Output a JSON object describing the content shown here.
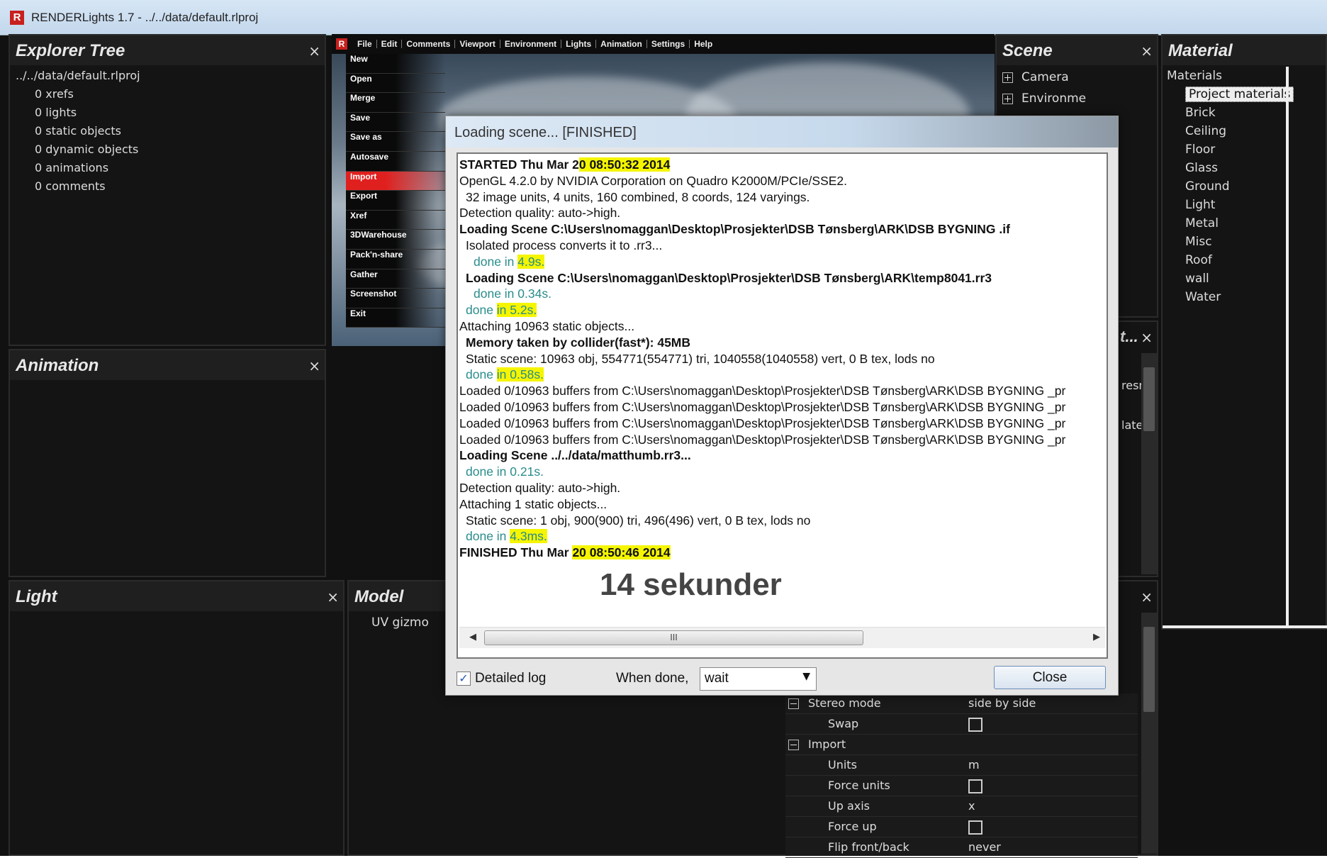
{
  "window": {
    "title": "RENDERLights 1.7 - ../../data/default.rlproj",
    "logo": "R"
  },
  "explorer": {
    "title": "Explorer Tree",
    "close": "×",
    "items": [
      "../../data/default.rlproj",
      "0 xrefs",
      "0 lights",
      "0 static objects",
      "0 dynamic objects",
      "0 animations",
      "0 comments"
    ]
  },
  "animation": {
    "title": "Animation",
    "close": "×"
  },
  "light": {
    "title": "Light",
    "close": "×"
  },
  "model": {
    "title": "Model",
    "close": "×",
    "item": "UV gizmo"
  },
  "scene": {
    "title": "Scene",
    "close": "×",
    "items": [
      "Camera",
      "Environme"
    ]
  },
  "material": {
    "title": "Material",
    "root": "Materials",
    "items": [
      "Project materials",
      "Brick",
      "Ceiling",
      "Floor",
      "Glass",
      "Ground",
      "Light",
      "Metal",
      "Misc",
      "Roof",
      "wall",
      "Water"
    ]
  },
  "midpanel": {
    "title": "t...",
    "close": "×",
    "frag1": "resn",
    "frag2": "late"
  },
  "lowpanel": {
    "close": "×"
  },
  "menubar": [
    "File",
    "Edit",
    "Comments",
    "Viewport",
    "Environment",
    "Lights",
    "Animation",
    "Settings",
    "Help"
  ],
  "filemenu": [
    "New",
    "Open",
    "Merge",
    "Save",
    "Save as",
    "Autosave",
    "Import",
    "Export",
    "Xref",
    "3DWarehouse",
    "Pack'n-share",
    "Gather",
    "Screenshot",
    "Exit"
  ],
  "filemenu_active": "Import",
  "properties": {
    "rows": [
      {
        "label": "Stereo mode",
        "value": "side by side",
        "group": true
      },
      {
        "label": "Swap",
        "checkbox": true
      },
      {
        "label": "Import",
        "group": true
      },
      {
        "label": "Units",
        "value": "m"
      },
      {
        "label": "Force units",
        "checkbox": true
      },
      {
        "label": "Up axis",
        "value": "x"
      },
      {
        "label": "Force up",
        "checkbox": true
      },
      {
        "label": "Flip front/back",
        "value": "never"
      }
    ]
  },
  "dialog": {
    "title": "Loading scene... [FINISHED]",
    "log": {
      "l1_a": "STARTED Thu Mar 2",
      "l1_b": "0 08:50:32 2014",
      "l2": "OpenGL 4.2.0 by NVIDIA Corporation on Quadro K2000M/PCIe/SSE2.",
      "l3": "32 image units, 4 units, 160 combined, 8 coords, 124 varyings.",
      "l4": "Detection quality: auto->high.",
      "l5": "Loading Scene C:\\Users\\nomaggan\\Desktop\\Prosjekter\\DSB Tønsberg\\ARK\\DSB BYGNING .if",
      "l6": "Isolated process converts it to .rr3...",
      "l7_a": "done in ",
      "l7_b": "4.9s.",
      "l8": "Loading Scene C:\\Users\\nomaggan\\Desktop\\Prosjekter\\DSB Tønsberg\\ARK\\temp8041.rr3",
      "l9": "done in 0.34s.",
      "l10_a": "done ",
      "l10_b": "in 5.2s.",
      "l11": "Attaching 10963 static objects...",
      "l12": "Memory taken by collider(fast*): 45MB",
      "l13": "Static scene: 10963 obj, 554771(554771) tri, 1040558(1040558) vert, 0 B tex, lods no",
      "l14_a": "done ",
      "l14_b": "in 0.58s.",
      "l15": "Loaded 0/10963 buffers from C:\\Users\\nomaggan\\Desktop\\Prosjekter\\DSB Tønsberg\\ARK\\DSB BYGNING _pr",
      "l16": "Loaded 0/10963 buffers from C:\\Users\\nomaggan\\Desktop\\Prosjekter\\DSB Tønsberg\\ARK\\DSB BYGNING _pr",
      "l17": "Loaded 0/10963 buffers from C:\\Users\\nomaggan\\Desktop\\Prosjekter\\DSB Tønsberg\\ARK\\DSB BYGNING _pr",
      "l18": "Loaded 0/10963 buffers from C:\\Users\\nomaggan\\Desktop\\Prosjekter\\DSB Tønsberg\\ARK\\DSB BYGNING _pr",
      "l19": "Loading Scene ../../data/matthumb.rr3...",
      "l20": "done in 0.21s.",
      "l21": "Detection quality: auto->high.",
      "l22": "Attaching 1 static objects...",
      "l23": "Static scene: 1 obj, 900(900) tri, 496(496) vert, 0 B tex, lods no",
      "l24_a": "done in ",
      "l24_b": "4.3ms.",
      "l25_a": "FINISHED Thu Mar ",
      "l25_b": "20 08:50:46 2014"
    },
    "annotation": "14 sekunder",
    "scroll_thumb": "III",
    "detailed_log": "Detailed log",
    "when_done": "When done,",
    "when_done_value": "wait",
    "close": "Close"
  }
}
